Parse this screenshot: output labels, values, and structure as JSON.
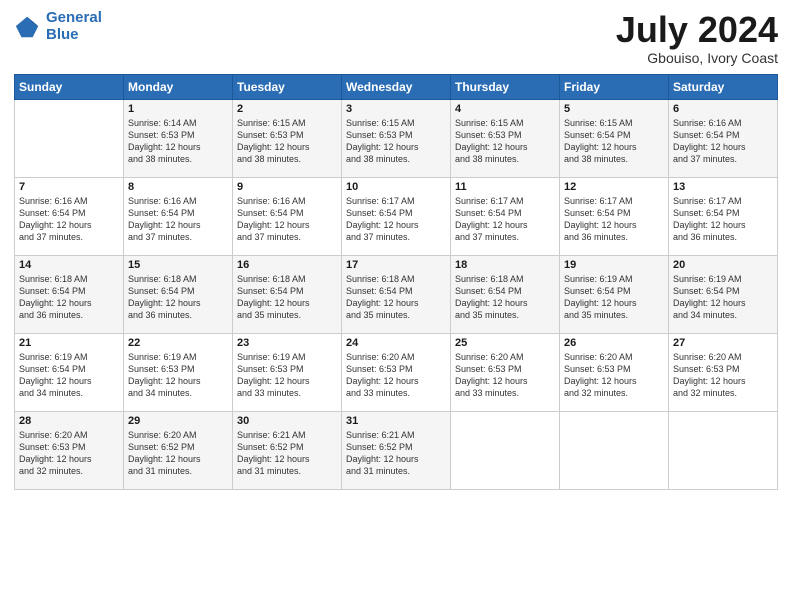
{
  "header": {
    "logo_line1": "General",
    "logo_line2": "Blue",
    "title": "July 2024",
    "location": "Gbouiso, Ivory Coast"
  },
  "days_of_week": [
    "Sunday",
    "Monday",
    "Tuesday",
    "Wednesday",
    "Thursday",
    "Friday",
    "Saturday"
  ],
  "weeks": [
    [
      {
        "day": "",
        "info": ""
      },
      {
        "day": "1",
        "info": "Sunrise: 6:14 AM\nSunset: 6:53 PM\nDaylight: 12 hours\nand 38 minutes."
      },
      {
        "day": "2",
        "info": "Sunrise: 6:15 AM\nSunset: 6:53 PM\nDaylight: 12 hours\nand 38 minutes."
      },
      {
        "day": "3",
        "info": "Sunrise: 6:15 AM\nSunset: 6:53 PM\nDaylight: 12 hours\nand 38 minutes."
      },
      {
        "day": "4",
        "info": "Sunrise: 6:15 AM\nSunset: 6:53 PM\nDaylight: 12 hours\nand 38 minutes."
      },
      {
        "day": "5",
        "info": "Sunrise: 6:15 AM\nSunset: 6:54 PM\nDaylight: 12 hours\nand 38 minutes."
      },
      {
        "day": "6",
        "info": "Sunrise: 6:16 AM\nSunset: 6:54 PM\nDaylight: 12 hours\nand 37 minutes."
      }
    ],
    [
      {
        "day": "7",
        "info": "Sunrise: 6:16 AM\nSunset: 6:54 PM\nDaylight: 12 hours\nand 37 minutes."
      },
      {
        "day": "8",
        "info": "Sunrise: 6:16 AM\nSunset: 6:54 PM\nDaylight: 12 hours\nand 37 minutes."
      },
      {
        "day": "9",
        "info": "Sunrise: 6:16 AM\nSunset: 6:54 PM\nDaylight: 12 hours\nand 37 minutes."
      },
      {
        "day": "10",
        "info": "Sunrise: 6:17 AM\nSunset: 6:54 PM\nDaylight: 12 hours\nand 37 minutes."
      },
      {
        "day": "11",
        "info": "Sunrise: 6:17 AM\nSunset: 6:54 PM\nDaylight: 12 hours\nand 37 minutes."
      },
      {
        "day": "12",
        "info": "Sunrise: 6:17 AM\nSunset: 6:54 PM\nDaylight: 12 hours\nand 36 minutes."
      },
      {
        "day": "13",
        "info": "Sunrise: 6:17 AM\nSunset: 6:54 PM\nDaylight: 12 hours\nand 36 minutes."
      }
    ],
    [
      {
        "day": "14",
        "info": "Sunrise: 6:18 AM\nSunset: 6:54 PM\nDaylight: 12 hours\nand 36 minutes."
      },
      {
        "day": "15",
        "info": "Sunrise: 6:18 AM\nSunset: 6:54 PM\nDaylight: 12 hours\nand 36 minutes."
      },
      {
        "day": "16",
        "info": "Sunrise: 6:18 AM\nSunset: 6:54 PM\nDaylight: 12 hours\nand 35 minutes."
      },
      {
        "day": "17",
        "info": "Sunrise: 6:18 AM\nSunset: 6:54 PM\nDaylight: 12 hours\nand 35 minutes."
      },
      {
        "day": "18",
        "info": "Sunrise: 6:18 AM\nSunset: 6:54 PM\nDaylight: 12 hours\nand 35 minutes."
      },
      {
        "day": "19",
        "info": "Sunrise: 6:19 AM\nSunset: 6:54 PM\nDaylight: 12 hours\nand 35 minutes."
      },
      {
        "day": "20",
        "info": "Sunrise: 6:19 AM\nSunset: 6:54 PM\nDaylight: 12 hours\nand 34 minutes."
      }
    ],
    [
      {
        "day": "21",
        "info": "Sunrise: 6:19 AM\nSunset: 6:54 PM\nDaylight: 12 hours\nand 34 minutes."
      },
      {
        "day": "22",
        "info": "Sunrise: 6:19 AM\nSunset: 6:53 PM\nDaylight: 12 hours\nand 34 minutes."
      },
      {
        "day": "23",
        "info": "Sunrise: 6:19 AM\nSunset: 6:53 PM\nDaylight: 12 hours\nand 33 minutes."
      },
      {
        "day": "24",
        "info": "Sunrise: 6:20 AM\nSunset: 6:53 PM\nDaylight: 12 hours\nand 33 minutes."
      },
      {
        "day": "25",
        "info": "Sunrise: 6:20 AM\nSunset: 6:53 PM\nDaylight: 12 hours\nand 33 minutes."
      },
      {
        "day": "26",
        "info": "Sunrise: 6:20 AM\nSunset: 6:53 PM\nDaylight: 12 hours\nand 32 minutes."
      },
      {
        "day": "27",
        "info": "Sunrise: 6:20 AM\nSunset: 6:53 PM\nDaylight: 12 hours\nand 32 minutes."
      }
    ],
    [
      {
        "day": "28",
        "info": "Sunrise: 6:20 AM\nSunset: 6:53 PM\nDaylight: 12 hours\nand 32 minutes."
      },
      {
        "day": "29",
        "info": "Sunrise: 6:20 AM\nSunset: 6:52 PM\nDaylight: 12 hours\nand 31 minutes."
      },
      {
        "day": "30",
        "info": "Sunrise: 6:21 AM\nSunset: 6:52 PM\nDaylight: 12 hours\nand 31 minutes."
      },
      {
        "day": "31",
        "info": "Sunrise: 6:21 AM\nSunset: 6:52 PM\nDaylight: 12 hours\nand 31 minutes."
      },
      {
        "day": "",
        "info": ""
      },
      {
        "day": "",
        "info": ""
      },
      {
        "day": "",
        "info": ""
      }
    ]
  ]
}
